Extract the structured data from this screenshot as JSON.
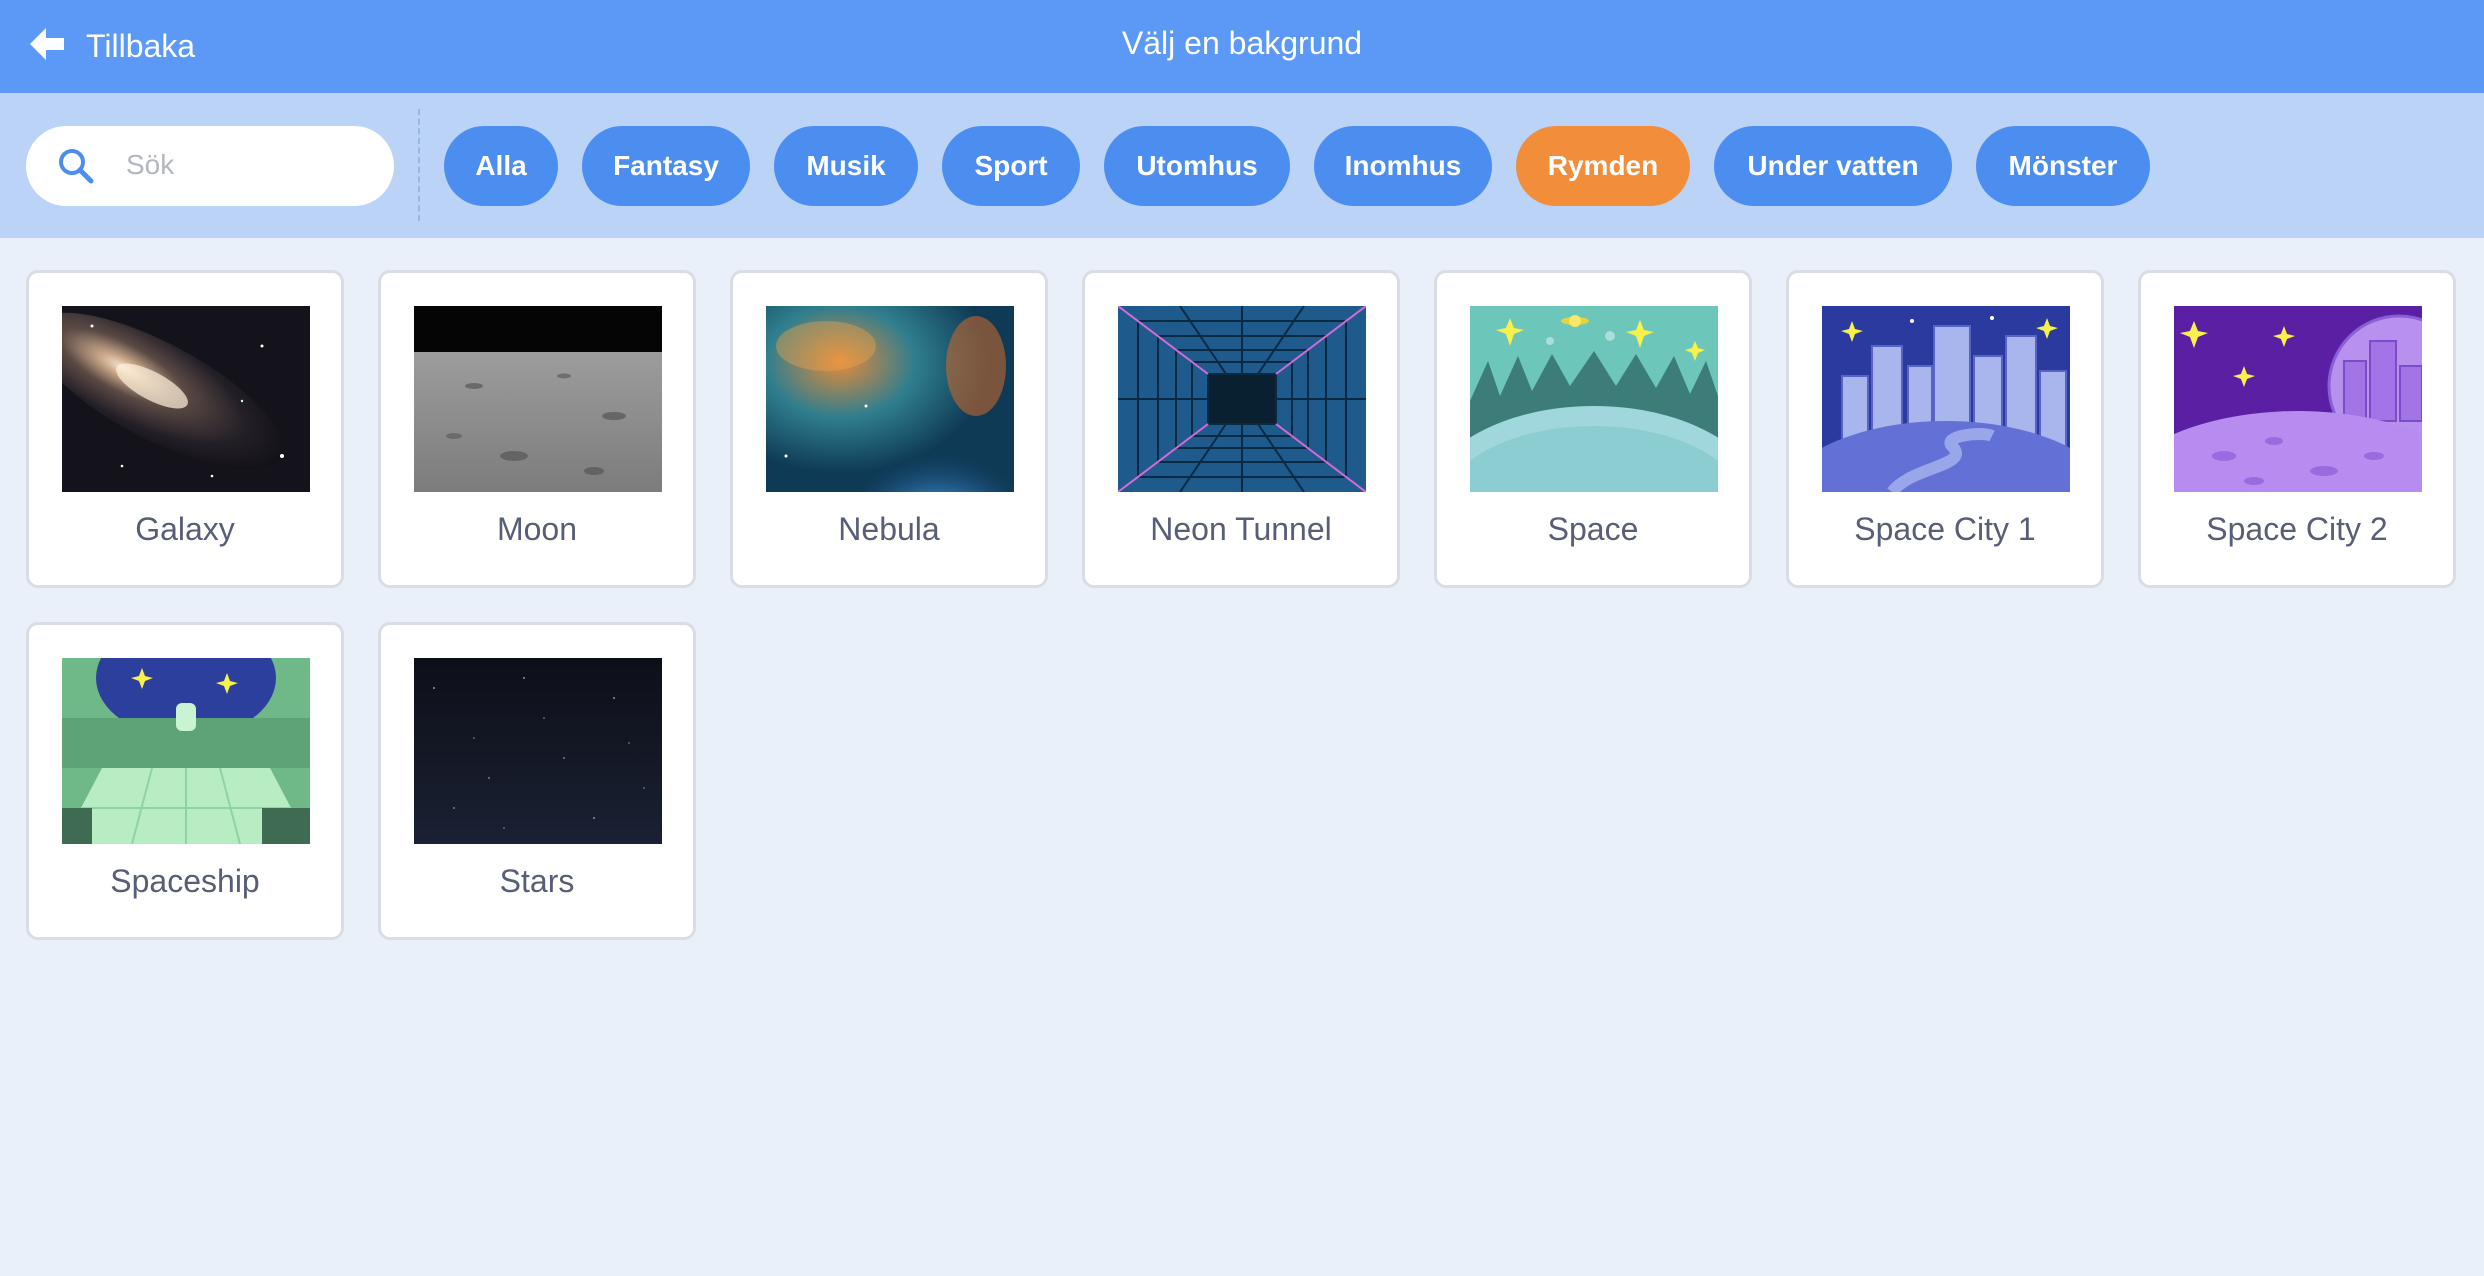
{
  "header": {
    "back_label": "Tillbaka",
    "title": "Välj en bakgrund"
  },
  "search": {
    "placeholder": "Sök",
    "value": ""
  },
  "tags": [
    {
      "label": "Alla",
      "active": false
    },
    {
      "label": "Fantasy",
      "active": false
    },
    {
      "label": "Musik",
      "active": false
    },
    {
      "label": "Sport",
      "active": false
    },
    {
      "label": "Utomhus",
      "active": false
    },
    {
      "label": "Inomhus",
      "active": false
    },
    {
      "label": "Rymden",
      "active": true
    },
    {
      "label": "Under vatten",
      "active": false
    },
    {
      "label": "Mönster",
      "active": false
    }
  ],
  "backdrops": [
    {
      "label": "Galaxy",
      "icon": "galaxy-thumbnail"
    },
    {
      "label": "Moon",
      "icon": "moon-thumbnail"
    },
    {
      "label": "Nebula",
      "icon": "nebula-thumbnail"
    },
    {
      "label": "Neon Tunnel",
      "icon": "neon-tunnel-thumbnail"
    },
    {
      "label": "Space",
      "icon": "space-thumbnail"
    },
    {
      "label": "Space City 1",
      "icon": "space-city-1-thumbnail"
    },
    {
      "label": "Space City 2",
      "icon": "space-city-2-thumbnail"
    },
    {
      "label": "Spaceship",
      "icon": "spaceship-thumbnail"
    },
    {
      "label": "Stars",
      "icon": "stars-thumbnail"
    }
  ],
  "colors": {
    "header": "#5c99f7",
    "filter_bar": "#bad3f7",
    "tag": "#4c8ef0",
    "tag_active": "#f28d39",
    "background": "#e9f0fa",
    "label_text": "#575e75"
  }
}
